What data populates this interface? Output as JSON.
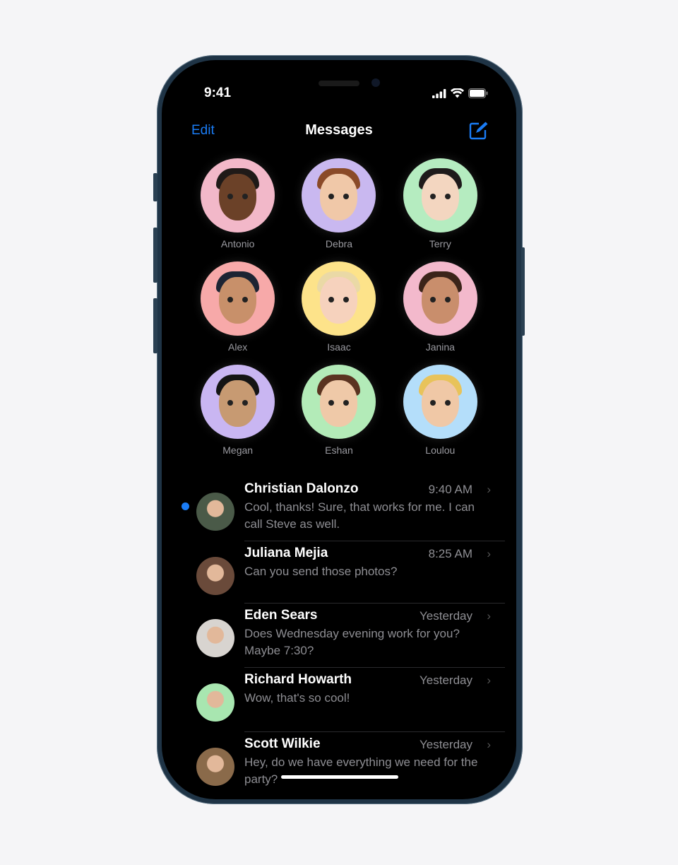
{
  "status_bar": {
    "time": "9:41"
  },
  "nav": {
    "edit_label": "Edit",
    "title": "Messages"
  },
  "colors": {
    "accent": "#1a7cf5",
    "secondary_text": "#8e8e93",
    "background": "#000000"
  },
  "pinned": [
    {
      "name": "Antonio",
      "bg": "#f2b8c9",
      "skin": "#6b4128",
      "hair": "#1f1a18"
    },
    {
      "name": "Debra",
      "bg": "#c9b8f0",
      "skin": "#f0c8a8",
      "hair": "#8a4a28"
    },
    {
      "name": "Terry",
      "bg": "#b5ecc0",
      "skin": "#f3d6c0",
      "hair": "#1e1a1a"
    },
    {
      "name": "Alex",
      "bg": "#f7a9a9",
      "skin": "#c8906a",
      "hair": "#1d2433"
    },
    {
      "name": "Isaac",
      "bg": "#fde38a",
      "skin": "#f6d2bd",
      "hair": "#ead9a6"
    },
    {
      "name": "Janina",
      "bg": "#f3b9cc",
      "skin": "#c98e6c",
      "hair": "#3b2419"
    },
    {
      "name": "Megan",
      "bg": "#c9b6f2",
      "skin": "#c79a72",
      "hair": "#141414"
    },
    {
      "name": "Eshan",
      "bg": "#b3ebb8",
      "skin": "#efc9a8",
      "hair": "#5a3320"
    },
    {
      "name": "Loulou",
      "bg": "#b4defa",
      "skin": "#f0c8a6",
      "hair": "#e8c35a"
    }
  ],
  "conversations": [
    {
      "name": "Christian Dalonzo",
      "time": "9:40 AM",
      "message": "Cool, thanks! Sure, that works for me. I can call Steve as well.",
      "unread": true,
      "avatar_color": "#4a5a48"
    },
    {
      "name": "Juliana Mejia",
      "time": "8:25 AM",
      "message": "Can you send those photos?",
      "unread": false,
      "avatar_color": "#6a4a3a"
    },
    {
      "name": "Eden Sears",
      "time": "Yesterday",
      "message": "Does Wednesday evening work for you? Maybe 7:30?",
      "unread": false,
      "avatar_color": "#d8d4d0"
    },
    {
      "name": "Richard Howarth",
      "time": "Yesterday",
      "message": "Wow, that's so cool!",
      "unread": false,
      "avatar_color": "#a8e6b0"
    },
    {
      "name": "Scott Wilkie",
      "time": "Yesterday",
      "message": "Hey, do we have everything we need for the party?",
      "unread": false,
      "avatar_color": "#8a6a4a"
    }
  ]
}
